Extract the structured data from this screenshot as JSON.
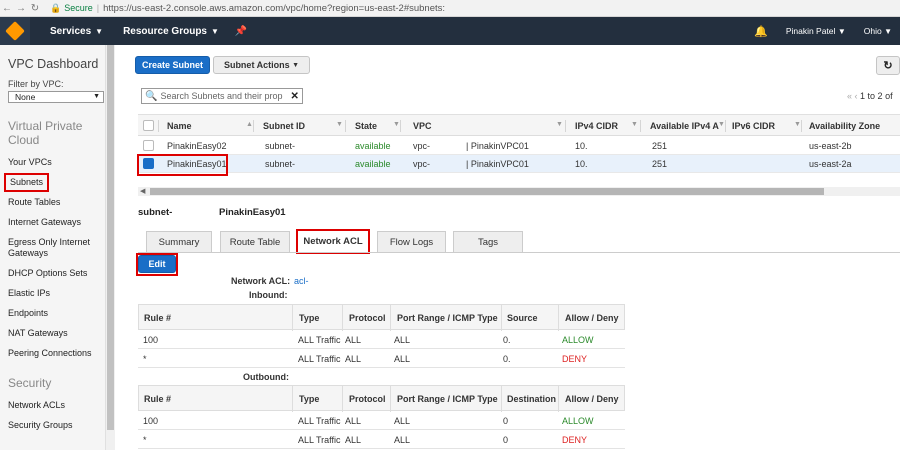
{
  "browser": {
    "secure": "Secure",
    "url": "https://us-east-2.console.aws.amazon.com/vpc/home?region=us-east-2#subnets:"
  },
  "nav": {
    "services": "Services",
    "resource_groups": "Resource Groups",
    "user": "Pinakin Patel",
    "region": "Ohio"
  },
  "sidebar": {
    "title": "VPC Dashboard",
    "filter_label": "Filter by VPC:",
    "filter_value": "None",
    "section_vpc_line1": "Virtual Private",
    "section_vpc_line2": "Cloud",
    "items": [
      "Your VPCs",
      "Subnets",
      "Route Tables",
      "Internet Gateways",
      "Egress Only Internet Gateways",
      "DHCP Options Sets",
      "Elastic IPs",
      "Endpoints",
      "NAT Gateways",
      "Peering Connections"
    ],
    "section_security": "Security",
    "security_items": [
      "Network ACLs",
      "Security Groups"
    ]
  },
  "toolbar": {
    "create_subnet": "Create Subnet",
    "subnet_actions": "Subnet Actions"
  },
  "search": {
    "placeholder": "Search Subnets and their prop"
  },
  "pager": {
    "text": "1 to 2 of"
  },
  "grid": {
    "columns": [
      "Name",
      "Subnet ID",
      "State",
      "VPC",
      "IPv4 CIDR",
      "Available IPv4 A",
      "IPv6 CIDR",
      "Availability Zone"
    ],
    "rows": [
      {
        "name": "PinakinEasy02",
        "subnet_id": "subnet-",
        "state": "available",
        "vpc": "vpc-",
        "vpc_name": "| PinakinVPC01",
        "cidr": "10.",
        "available": "251",
        "ipv6": "",
        "az": "us-east-2b"
      },
      {
        "name": "PinakinEasy01",
        "subnet_id": "subnet-",
        "state": "available",
        "vpc": "vpc-",
        "vpc_name": "| PinakinVPC01",
        "cidr": "10.",
        "available": "251",
        "ipv6": "",
        "az": "us-east-2a"
      }
    ]
  },
  "detail": {
    "subnet_id": "subnet-",
    "subnet_name": "PinakinEasy01",
    "tabs": [
      "Summary",
      "Route Table",
      "Network ACL",
      "Flow Logs",
      "Tags"
    ],
    "edit": "Edit",
    "network_acl_label": "Network ACL:",
    "network_acl_value": "acl-",
    "inbound_label": "Inbound:",
    "outbound_label": "Outbound:",
    "inbound_columns": [
      "Rule #",
      "Type",
      "Protocol",
      "Port Range / ICMP Type",
      "Source",
      "Allow / Deny"
    ],
    "inbound_rows": [
      {
        "rule": "100",
        "type": "ALL Traffic",
        "protocol": "ALL",
        "port": "ALL",
        "source": "0.",
        "action": "ALLOW"
      },
      {
        "rule": "*",
        "type": "ALL Traffic",
        "protocol": "ALL",
        "port": "ALL",
        "source": "0.",
        "action": "DENY"
      }
    ],
    "outbound_columns": [
      "Rule #",
      "Type",
      "Protocol",
      "Port Range / ICMP Type",
      "Destination",
      "Allow / Deny"
    ],
    "outbound_rows": [
      {
        "rule": "100",
        "type": "ALL Traffic",
        "protocol": "ALL",
        "port": "ALL",
        "dest": "0",
        "action": "ALLOW"
      },
      {
        "rule": "*",
        "type": "ALL Traffic",
        "protocol": "ALL",
        "port": "ALL",
        "dest": "0",
        "action": "DENY"
      }
    ]
  },
  "colors": {
    "aws_nav": "#232f3e",
    "primary": "#1a6ec7",
    "allow": "#2b8a2b",
    "deny": "#dd2222",
    "highlight": "#dd0000"
  }
}
